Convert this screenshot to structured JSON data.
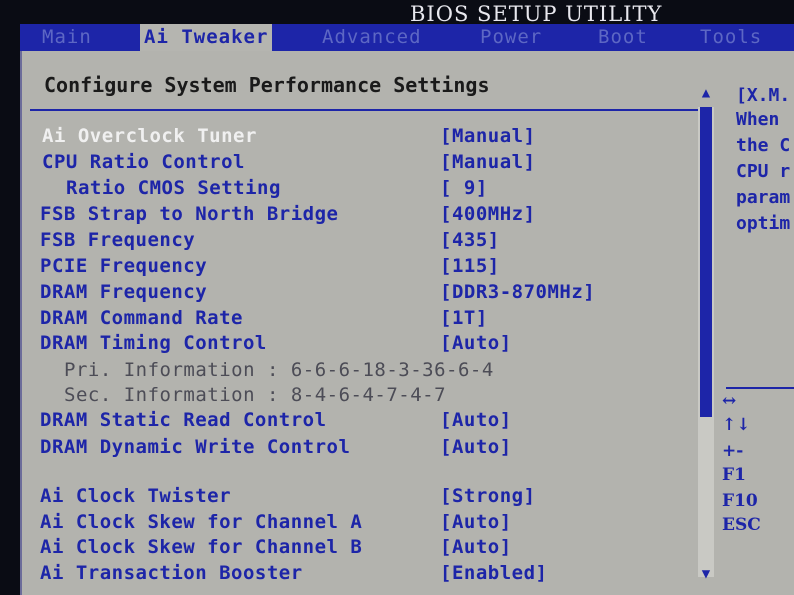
{
  "window_title": "BIOS SETUP UTILITY",
  "tabs": [
    {
      "label": "Main",
      "active": false
    },
    {
      "label": "Ai Tweaker",
      "active": true
    },
    {
      "label": "Advanced",
      "active": false
    },
    {
      "label": "Power",
      "active": false
    },
    {
      "label": "Boot",
      "active": false
    },
    {
      "label": "Tools",
      "active": false
    }
  ],
  "panel": {
    "heading": "Configure System Performance Settings",
    "settings": [
      {
        "label": "Ai Overclock Tuner",
        "value": "[Manual]",
        "selected": true
      },
      {
        "label": "CPU Ratio Control",
        "value": "[Manual]"
      },
      {
        "label": "Ratio CMOS Setting",
        "value": "[ 9]",
        "indent": true
      },
      {
        "label": "FSB Strap to North Bridge",
        "value": "[400MHz]"
      },
      {
        "label": "FSB Frequency",
        "value": "[435]"
      },
      {
        "label": "PCIE Frequency",
        "value": "[115]"
      },
      {
        "label": "DRAM Frequency",
        "value": "[DDR3-870MHz]"
      },
      {
        "label": "DRAM Command Rate",
        "value": "[1T]"
      },
      {
        "label": "DRAM Timing Control",
        "value": "[Auto]"
      },
      {
        "label": "Pri. Information : 6-6-6-18-3-36-6-4",
        "value": "",
        "info": true
      },
      {
        "label": "Sec. Information : 8-4-6-4-7-4-7",
        "value": "",
        "info": true
      },
      {
        "label": "DRAM Static Read Control",
        "value": "[Auto]"
      },
      {
        "label": "DRAM Dynamic Write Control",
        "value": "[Auto]"
      },
      {
        "label": "Ai Clock Twister",
        "value": "[Strong]"
      },
      {
        "label": "Ai Clock Skew for Channel A",
        "value": "[Auto]"
      },
      {
        "label": "Ai Clock Skew for Channel B",
        "value": "[Auto]"
      },
      {
        "label": "Ai Transaction Booster",
        "value": "[Enabled]"
      }
    ]
  },
  "help": {
    "lines": [
      "[X.M.",
      "When",
      "the C",
      "CPU r",
      "param",
      "optim"
    ],
    "keys": [
      "↔",
      "↑↓",
      "+-",
      "F1",
      "F10",
      "ESC"
    ]
  },
  "scroll_position": 0.0,
  "colors": {
    "accent": "#1d25a8",
    "panel": "#b3b3ae",
    "selected_text": "#f0f0f0"
  }
}
